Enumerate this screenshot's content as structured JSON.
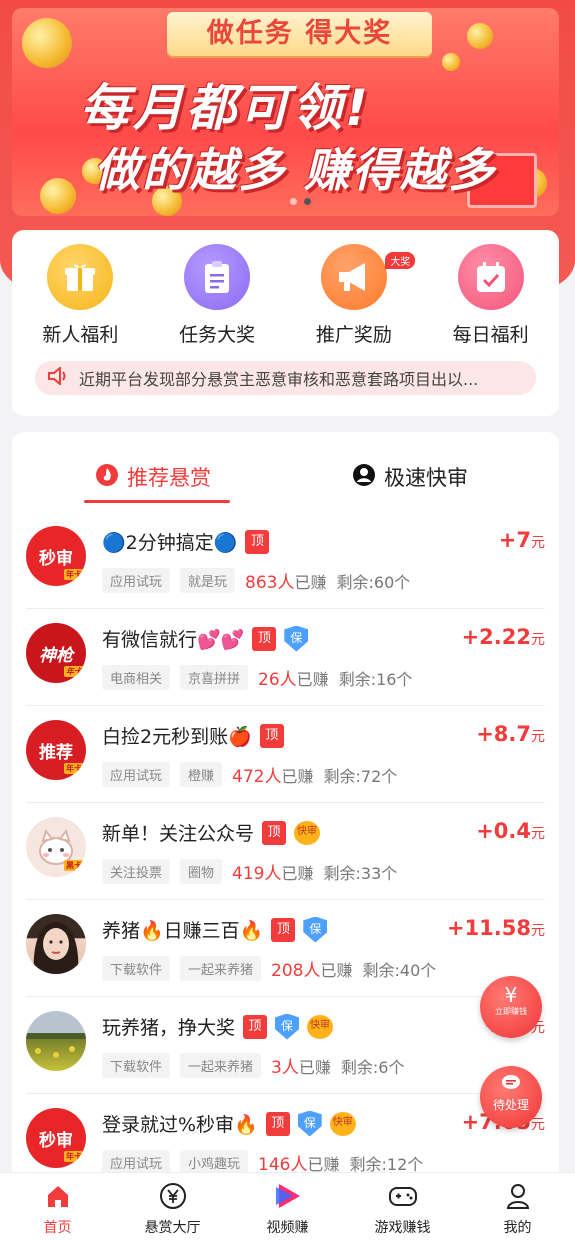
{
  "banner": {
    "ribbon": "做任务 得大奖",
    "line1": "每月都可领!",
    "line2": "做的越多 赚得越多",
    "active_dot": 2
  },
  "quick_entries": [
    {
      "label": "新人福利",
      "icon": "gift-icon",
      "color": "#f7b51b"
    },
    {
      "label": "任务大奖",
      "icon": "clipboard-icon",
      "color": "#8b6af2"
    },
    {
      "label": "推广奖励",
      "icon": "megaphone-icon",
      "color": "#ff7a2a",
      "badge": "大奖"
    },
    {
      "label": "每日福利",
      "icon": "calendar-icon",
      "color": "#f4547a"
    }
  ],
  "notice": {
    "text": "近期平台发现部分悬赏主恶意审核和恶意套路项目出以..."
  },
  "tabs": [
    {
      "label": "推荐悬赏",
      "icon": "flame-icon",
      "active": true
    },
    {
      "label": "极速快审",
      "icon": "user-icon",
      "active": false
    }
  ],
  "tasks": [
    {
      "avatar_text": "秒审",
      "avatar_badge": "年卡",
      "avatar_color": "#e8262a",
      "title": "🔵2分钟搞定🔵",
      "tags": [
        "顶"
      ],
      "chips": [
        "应用试玩",
        "就是玩"
      ],
      "earned_count": "863人",
      "earned_suffix": "已赚",
      "remaining": "剩余:60个",
      "reward": "+7",
      "unit": "元"
    },
    {
      "avatar_text": "神枪",
      "avatar_badge": "年卡",
      "avatar_color": "#c8161c",
      "title": "有微信就行💕💕",
      "tags": [
        "顶",
        "保"
      ],
      "chips": [
        "电商相关",
        "京喜拼拼"
      ],
      "earned_count": "26人",
      "earned_suffix": "已赚",
      "remaining": "剩余:16个",
      "reward": "+2.22",
      "unit": "元"
    },
    {
      "avatar_text": "推荐",
      "avatar_badge": "年卡",
      "avatar_color": "#d81e22",
      "title": "白捡2元秒到账🍎",
      "tags": [
        "顶"
      ],
      "chips": [
        "应用试玩",
        "橙赚"
      ],
      "earned_count": "472人",
      "earned_suffix": "已赚",
      "remaining": "剩余:72个",
      "reward": "+8.7",
      "unit": "元"
    },
    {
      "avatar_text": "",
      "avatar_badge": "黑卡",
      "avatar_color": "#f6e6e0",
      "title": "新单！关注公众号",
      "tags": [
        "顶",
        "快审"
      ],
      "chips": [
        "关注投票",
        "圈物"
      ],
      "earned_count": "419人",
      "earned_suffix": "已赚",
      "remaining": "剩余:33个",
      "reward": "+0.4",
      "unit": "元"
    },
    {
      "avatar_text": "",
      "avatar_badge": "",
      "avatar_color": "#8c6a5a",
      "title": "养猪🔥日赚三百🔥",
      "tags": [
        "顶",
        "保"
      ],
      "chips": [
        "下载软件",
        "一起来养猪"
      ],
      "earned_count": "208人",
      "earned_suffix": "已赚",
      "remaining": "剩余:40个",
      "reward": "+11.58",
      "unit": "元"
    },
    {
      "avatar_text": "",
      "avatar_badge": "",
      "avatar_color": "#7a8a3a",
      "title": "玩养猪，挣大奖",
      "tags": [
        "顶",
        "保",
        "快审"
      ],
      "chips": [
        "下载软件",
        "一起来养猪"
      ],
      "earned_count": "3人",
      "earned_suffix": "已赚",
      "remaining": "剩余:6个",
      "reward": "+10",
      "unit": "元"
    },
    {
      "avatar_text": "秒审",
      "avatar_badge": "年卡",
      "avatar_color": "#e8262a",
      "title": "登录就过%秒审🔥",
      "tags": [
        "顶",
        "保",
        "快审"
      ],
      "chips": [
        "应用试玩",
        "小鸡趣玩"
      ],
      "earned_count": "146人",
      "earned_suffix": "已赚",
      "remaining": "剩余:12个",
      "reward": "+7.05",
      "unit": "元"
    }
  ],
  "floats": {
    "earn": {
      "icon": "¥",
      "label": "立即赚钱"
    },
    "pending": {
      "icon": "💬",
      "label": "待处理"
    }
  },
  "bottom_nav": [
    {
      "label": "首页",
      "icon": "home-icon",
      "active": true
    },
    {
      "label": "悬赏大厅",
      "icon": "yen-circle-icon",
      "active": false
    },
    {
      "label": "视频赚",
      "icon": "video-play-icon",
      "active": false
    },
    {
      "label": "游戏赚钱",
      "icon": "gamepad-icon",
      "active": false
    },
    {
      "label": "我的",
      "icon": "person-icon",
      "active": false
    }
  ],
  "colors": {
    "accent": "#f23c3c",
    "background": "#f3f3f6"
  }
}
